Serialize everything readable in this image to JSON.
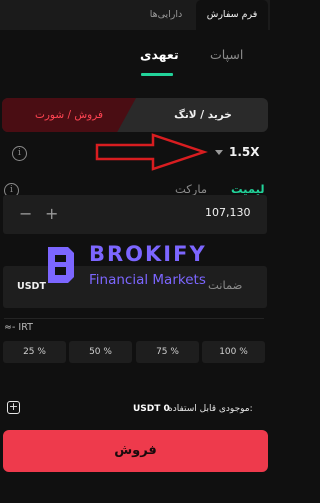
{
  "top_tabs": [
    {
      "label": "فرم سفارش",
      "active": true
    },
    {
      "label": "دارایی‌ها",
      "active": false
    }
  ],
  "market_tabs": [
    {
      "label": "تعهدی",
      "active": true
    },
    {
      "label": "اسپات",
      "active": false
    }
  ],
  "side_toggle": {
    "buy_label": "خرید / لانگ",
    "sell_label": "فروش / شورت",
    "selected": "sell"
  },
  "leverage": {
    "value": "1.5X"
  },
  "order_type": {
    "options": [
      "لیمیت",
      "مارکت"
    ],
    "selected": "لیمیت"
  },
  "price": {
    "value": "107,130",
    "minus": "−",
    "plus": "+"
  },
  "quantity": {
    "currency": "USDT",
    "label": "ضمانت"
  },
  "watermark": {
    "brand": "BROKIFY",
    "subtitle": "Financial Markets"
  },
  "irt_label": "≈- IRT",
  "percent_buttons": [
    "25 %",
    "50 %",
    "75 %",
    "100 %"
  ],
  "available_balance": {
    "label": "موجودی قابل استفاده:",
    "value": "USDT 0"
  },
  "submit_button": {
    "label": "فروش"
  },
  "colors": {
    "accent_green": "#22d39a",
    "sell_red": "#ee3a4c",
    "sell_tab_bg": "#4a0d13",
    "watermark_purple": "#7c66ff",
    "annotation_arrow_red": "#d81d20"
  },
  "icons": [
    "info-icon",
    "chevron-down-icon",
    "plus-icon",
    "red-arrow-annotation"
  ]
}
